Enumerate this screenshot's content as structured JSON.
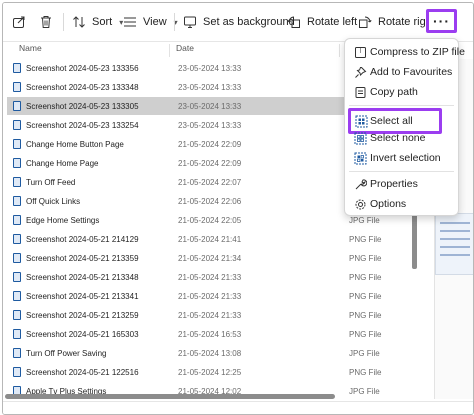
{
  "toolbar": {
    "sort_label": "Sort",
    "view_label": "View",
    "set_background_label": "Set as background",
    "rotate_left_label": "Rotate left",
    "rotate_right_label": "Rotate right",
    "more_label": "···"
  },
  "columns": {
    "name": "Name",
    "date": "Date"
  },
  "files": [
    {
      "name": "Screenshot 2024-05-23 133356",
      "date": "23-05-2024 13:33",
      "type": ""
    },
    {
      "name": "Screenshot 2024-05-23 133348",
      "date": "23-05-2024 13:33",
      "type": ""
    },
    {
      "name": "Screenshot 2024-05-23 133305",
      "date": "23-05-2024 13:33",
      "type": ""
    },
    {
      "name": "Screenshot 2024-05-23 133254",
      "date": "23-05-2024 13:33",
      "type": ""
    },
    {
      "name": "Change Home Button Page",
      "date": "21-05-2024 22:09",
      "type": ""
    },
    {
      "name": "Change Home Page",
      "date": "21-05-2024 22:09",
      "type": ""
    },
    {
      "name": "Turn Off Feed",
      "date": "21-05-2024 22:07",
      "type": ""
    },
    {
      "name": "Off Quick Links",
      "date": "21-05-2024 22:06",
      "type": ""
    },
    {
      "name": "Edge Home Settings",
      "date": "21-05-2024 22:05",
      "type": "JPG File"
    },
    {
      "name": "Screenshot 2024-05-21 214129",
      "date": "21-05-2024 21:41",
      "type": "PNG File"
    },
    {
      "name": "Screenshot 2024-05-21 213359",
      "date": "21-05-2024 21:34",
      "type": "PNG File"
    },
    {
      "name": "Screenshot 2024-05-21 213348",
      "date": "21-05-2024 21:33",
      "type": "PNG File"
    },
    {
      "name": "Screenshot 2024-05-21 213341",
      "date": "21-05-2024 21:33",
      "type": "PNG File"
    },
    {
      "name": "Screenshot 2024-05-21 213259",
      "date": "21-05-2024 21:33",
      "type": "PNG File"
    },
    {
      "name": "Screenshot 2024-05-21 165303",
      "date": "21-05-2024 16:53",
      "type": "PNG File"
    },
    {
      "name": "Turn Off Power Saving",
      "date": "21-05-2024 13:08",
      "type": "JPG File"
    },
    {
      "name": "Screenshot 2024-05-21 122516",
      "date": "21-05-2024 12:25",
      "type": "PNG File"
    },
    {
      "name": "Apple Tv Plus Settings",
      "date": "21-05-2024 12:02",
      "type": "JPG File"
    }
  ],
  "selected_index": 2,
  "menu": {
    "compress": "Compress to ZIP file",
    "favourites": "Add to Favourites",
    "copy_path": "Copy path",
    "select_all": "Select all",
    "select_none": "Select none",
    "invert_selection": "Invert selection",
    "properties": "Properties",
    "options": "Options"
  },
  "colors": {
    "highlight": "#9b3df0",
    "selected_row": "#cfcfcf",
    "icon_blue": "#1e5aa0"
  }
}
